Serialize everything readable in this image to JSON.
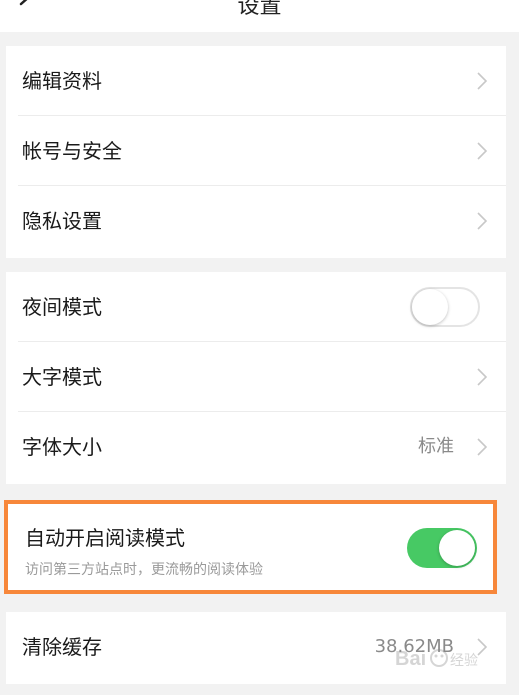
{
  "header": {
    "title": "设置",
    "back_icon": "back-arrow-icon"
  },
  "group1": {
    "items": [
      {
        "label": "编辑资料"
      },
      {
        "label": "帐号与安全"
      },
      {
        "label": "隐私设置"
      }
    ]
  },
  "group2": {
    "night_mode": {
      "label": "夜间模式",
      "toggle": "off"
    },
    "large_font": {
      "label": "大字模式"
    },
    "font_size": {
      "label": "字体大小",
      "value": "标准"
    }
  },
  "reading_mode": {
    "label": "自动开启阅读模式",
    "description": "访问第三方站点时，更流畅的阅读体验",
    "toggle": "on",
    "highlight_color": "#f7873a",
    "toggle_color": "#47c964"
  },
  "clear_cache": {
    "label": "清除缓存",
    "value": "38.62MB"
  },
  "watermark": {
    "text": "Baidu 经验"
  }
}
